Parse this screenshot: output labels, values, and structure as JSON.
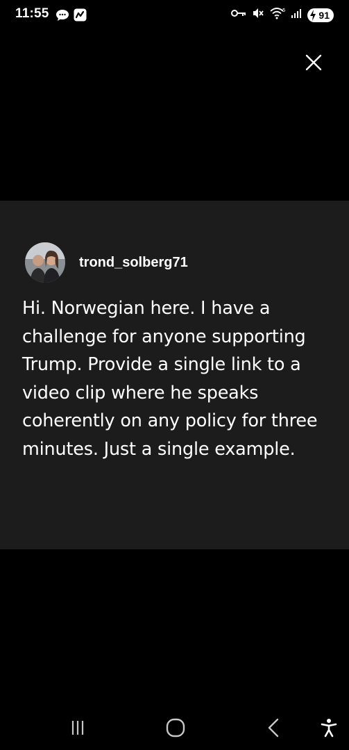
{
  "status_bar": {
    "time": "11:55",
    "battery_level": "91",
    "icons": [
      "chat-bubble-icon",
      "app-notification-icon",
      "vpn-key-icon",
      "mute-icon",
      "wifi-icon",
      "signal-icon",
      "battery-icon"
    ]
  },
  "comment": {
    "username": "trond_solberg71",
    "text": "Hi. Norwegian here. I have a challenge for anyone supporting Trump. Provide a single link to a video clip where he speaks coherently on any policy for three minutes. Just a single example."
  },
  "navigation": {
    "buttons": [
      "recent-apps",
      "home",
      "back",
      "accessibility"
    ]
  },
  "colors": {
    "background": "#000000",
    "card_background": "#1c1c1c",
    "text": "#ffffff"
  }
}
